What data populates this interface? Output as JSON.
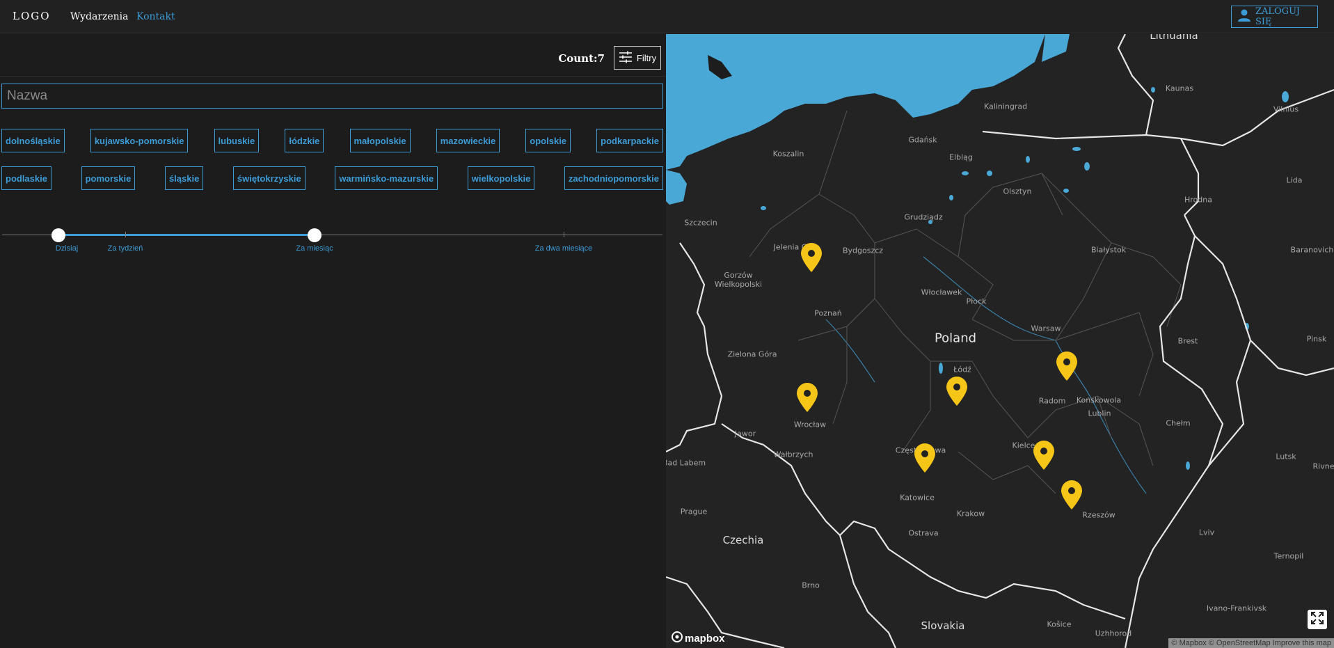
{
  "nav": {
    "logo": "LOGO",
    "links": [
      "Wydarzenia",
      "Kontakt"
    ],
    "login_label": "ZALOGUJ SIĘ"
  },
  "toolbar": {
    "count_label": "Count:7",
    "filter_label": "Filtry"
  },
  "search": {
    "placeholder": "Nazwa",
    "value": ""
  },
  "regions_row1": [
    "dolnośląskie",
    "kujawsko-pomorskie",
    "lubuskie",
    "łódzkie",
    "małopolskie",
    "mazowieckie",
    "opolskie",
    "podkarpackie"
  ],
  "regions_row2": [
    "podlaskie",
    "pomorskie",
    "śląskie",
    "świętokrzyskie",
    "warmińsko-mazurskie",
    "wielkopolskie",
    "zachodniopomorskie"
  ],
  "date_slider": {
    "marks": [
      "Dzisiaj",
      "Za tydzień",
      "Za miesiąc",
      "Za dwa miesiące"
    ],
    "range_start": "Dzisiaj",
    "range_end": "Za miesiąc"
  },
  "map": {
    "country_label": "Poland",
    "neighbor_labels": [
      "Lithuania",
      "Czechia",
      "Slovakia"
    ],
    "city_labels": [
      "Kaliningrad",
      "Gdańsk",
      "Elbląg",
      "Koszalin",
      "Olsztyn",
      "Grudziądz",
      "Bydgoszcz",
      "Szczecin",
      "Gorzów Wielkopolski",
      "Poznań",
      "Włocławek",
      "Płock",
      "Warsaw",
      "Białystok",
      "Łódź",
      "Zielona Góra",
      "Radom",
      "Końskowola",
      "Lublin",
      "Wrocław",
      "Wałbrzych",
      "Częstochowa",
      "Kielce",
      "Katowice",
      "Krakow",
      "Rzeszów",
      "Ostrava",
      "Prague",
      "Brno",
      "Chełm",
      "Brest",
      "Lutsk",
      "Lviv",
      "Ternopil",
      "Ivano-Frankivsk",
      "Košice",
      "Uzhhorod",
      "Kaunas",
      "Vilnius",
      "Lida",
      "Hrodna",
      "Baranovichi",
      "Pinsk",
      "Rivne",
      "Jelenia Góra",
      "Bad Labem",
      "Jawor"
    ],
    "marker_count": 7,
    "attribution": "© Mapbox © OpenStreetMap  Improve this map",
    "logo_text": "mapbox",
    "colors": {
      "water": "#4aa8d6",
      "marker": "#f5c518",
      "land": "#232323",
      "accent": "#3d9bd6"
    }
  }
}
